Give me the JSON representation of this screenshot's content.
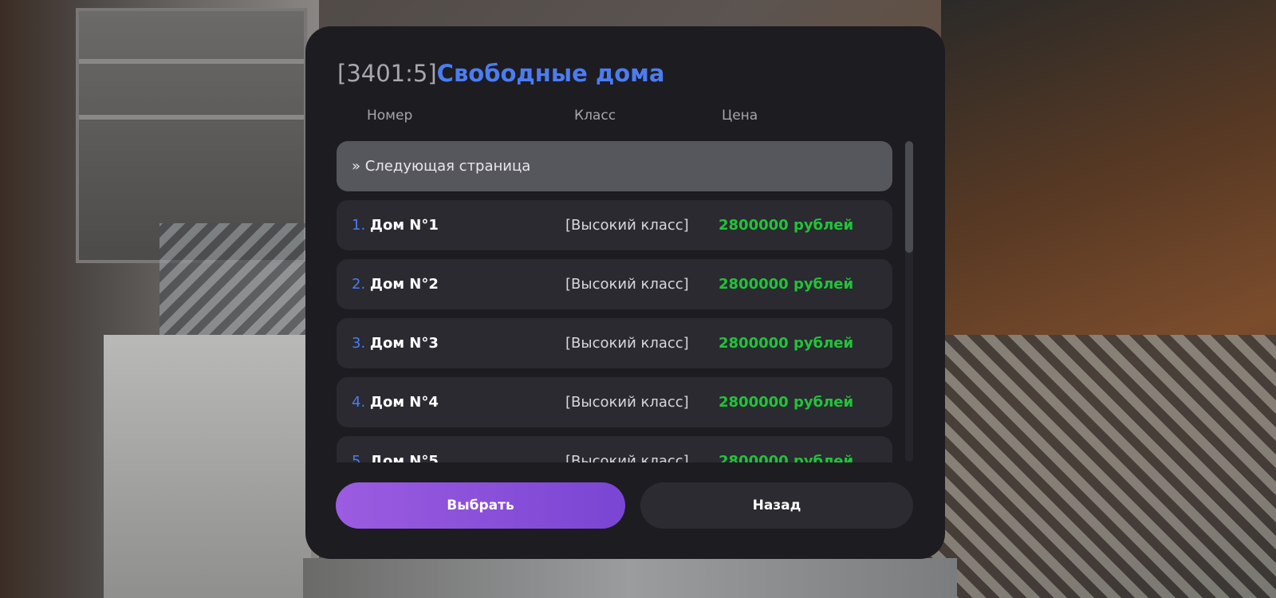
{
  "dialog": {
    "title_code": "[3401:5]",
    "title_name": "Свободные дома"
  },
  "columns": {
    "number": "Номер",
    "class": "Класс",
    "price": "Цена"
  },
  "list": {
    "next_page": "» Следующая страница",
    "items": [
      {
        "index": "1.",
        "name": "Дом N°1",
        "class": "[Высокий класс]",
        "price": "2800000 рублей"
      },
      {
        "index": "2.",
        "name": "Дом N°2",
        "class": "[Высокий класс]",
        "price": "2800000 рублей"
      },
      {
        "index": "3.",
        "name": "Дом N°3",
        "class": "[Высокий класс]",
        "price": "2800000 рублей"
      },
      {
        "index": "4.",
        "name": "Дом N°4",
        "class": "[Высокий класс]",
        "price": "2800000 рублей"
      },
      {
        "index": "5.",
        "name": "Дом N°5",
        "class": "[Высокий класс]",
        "price": "2800000 рублей"
      }
    ]
  },
  "buttons": {
    "select": "Выбрать",
    "back": "Назад"
  },
  "colors": {
    "accent_blue": "#4c7cf0",
    "price_green": "#22c33a",
    "select_button": "#8a50da",
    "dialog_bg": "#1c1c21"
  }
}
